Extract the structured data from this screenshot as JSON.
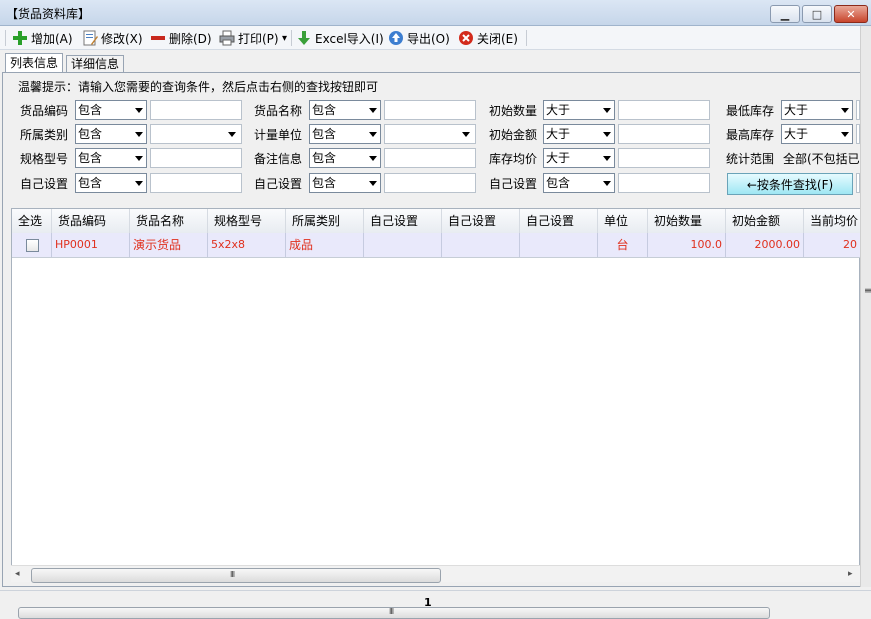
{
  "window": {
    "title": "【货品资料库】",
    "minimize": "▁",
    "maximize": "□",
    "close": "✕"
  },
  "toolbar": {
    "add": "增加(A)",
    "edit": "修改(X)",
    "delete": "删除(D)",
    "print": "打印(P)",
    "print_dropdown": "▾",
    "excel_import": "Excel导入(I)",
    "export": "导出(O)",
    "close": "关闭(E)"
  },
  "tabs": {
    "list": "列表信息",
    "detail": "详细信息"
  },
  "hint": "温馨提示：请输入您需要的查询条件，然后点击右侧的查找按钮即可",
  "search": {
    "rows": [
      [
        {
          "label": "货品编码",
          "op": "包含"
        },
        {
          "label": "货品名称",
          "op": "包含"
        },
        {
          "label": "初始数量",
          "op": "大于"
        },
        {
          "label": "最低库存",
          "op": "大于"
        }
      ],
      [
        {
          "label": "所属类别",
          "op": "包含"
        },
        {
          "label": "计量单位",
          "op": "包含"
        },
        {
          "label": "初始金额",
          "op": "大于"
        },
        {
          "label": "最高库存",
          "op": "大于"
        }
      ],
      [
        {
          "label": "规格型号",
          "op": "包含"
        },
        {
          "label": "备注信息",
          "op": "包含"
        },
        {
          "label": "库存均价",
          "op": "大于"
        }
      ],
      [
        {
          "label": "自己设置",
          "op": "包含"
        },
        {
          "label": "自己设置",
          "op": "包含"
        },
        {
          "label": "自己设置",
          "op": "包含"
        }
      ]
    ],
    "range_label": "统计范围",
    "range_value": "全部(不包括已",
    "find_button": "←按条件查找(F)"
  },
  "grid": {
    "columns": [
      "全选",
      "货品编码",
      "货品名称",
      "规格型号",
      "所属类别",
      "自己设置",
      "自己设置",
      "自己设置",
      "单位",
      "初始数量",
      "初始金额",
      "当前均价"
    ],
    "rows": [
      [
        "",
        "HP0001",
        "演示货品",
        "5x2x8",
        "成品",
        "",
        "",
        "",
        "台",
        "100.0",
        "2000.00",
        "20"
      ]
    ]
  },
  "scroll": {
    "grip": "III",
    "left": "◂",
    "right": "▸"
  },
  "footer": {
    "page": "1"
  }
}
